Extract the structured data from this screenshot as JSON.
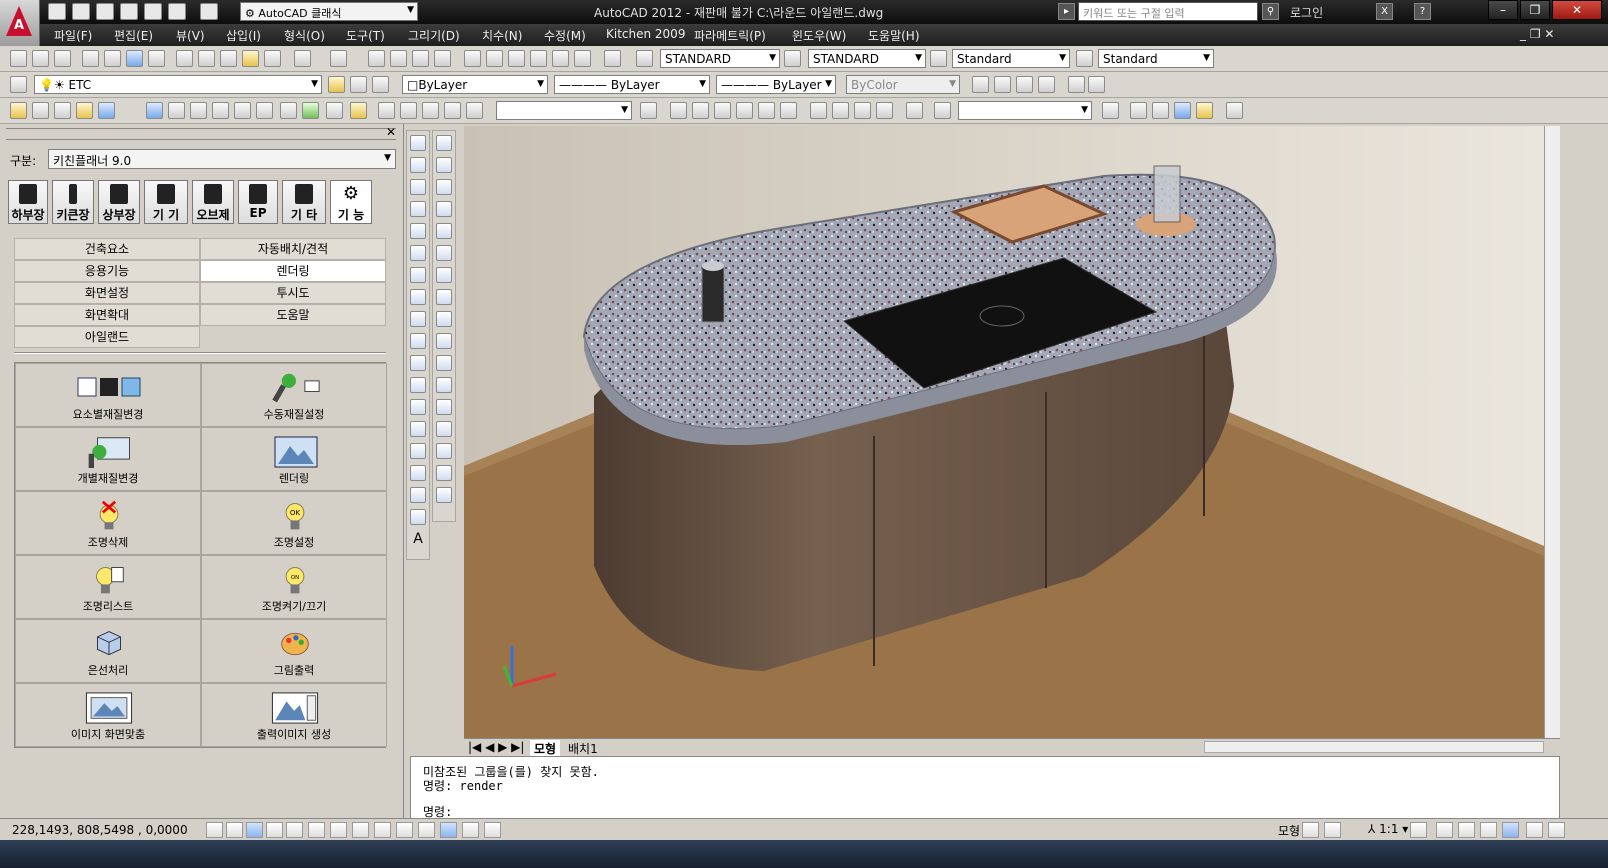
{
  "titlebar": {
    "workspace": "AutoCAD 클래식",
    "title": "AutoCAD 2012 - 재판매 불가    C:\\라운드 아일랜드.dwg",
    "search_placeholder": "키워드 또는 구절 입력",
    "login": "로그인"
  },
  "menu": [
    "파일(F)",
    "편집(E)",
    "뷰(V)",
    "삽입(I)",
    "형식(O)",
    "도구(T)",
    "그리기(D)",
    "치수(N)",
    "수정(M)",
    "Kitchen 2009",
    "파라메트릭(P)",
    "윈도우(W)",
    "도움말(H)"
  ],
  "styles": {
    "text_style": "STANDARD",
    "dim_style": "STANDARD",
    "table_style": "Standard",
    "mleader_style": "Standard"
  },
  "layers": {
    "current_layer": "ETC",
    "color": "ByLayer",
    "linetype": "ByLayer",
    "lineweight": "ByLayer",
    "plotstyle": "ByColor"
  },
  "panel": {
    "gubun_label": "구분:",
    "gubun_value": "키친플래너 9.0",
    "categories": [
      "하부장",
      "키큰장",
      "상부장",
      "기  기",
      "오브제",
      "EP",
      "기  타",
      "기  능"
    ],
    "menu_items": [
      "건축요소",
      "자동배치/견적",
      "응용기능",
      "렌더링",
      "화면설정",
      "투시도",
      "화면확대",
      "도움말",
      "아일랜드"
    ],
    "commands": [
      "요소별재질변경",
      "수동재질설정",
      "개별재질변경",
      "렌더링",
      "조명삭제",
      "조명설정",
      "조명리스트",
      "조명켜기/끄기",
      "은선처리",
      "그림출력",
      "이미지 화면맞춤",
      "출력이미지 생성"
    ]
  },
  "tabs": {
    "model": "모형",
    "layout": "배치1"
  },
  "command_line": {
    "line1": "미참조된 그룹을(를) 찾지 못함.",
    "line2": "명령: render",
    "prompt": "명령:"
  },
  "status": {
    "coords": "228,1493,  808,5498  , 0,0000",
    "model": "모형",
    "scale": "1:1"
  },
  "colors": {
    "title_bg": "#1a1a1a",
    "autocad_red": "#c8102e",
    "countertop": "#9ea3b0",
    "cabinet_wood": "#6b5749",
    "floor_wood": "#9a7448",
    "wall": "#dcd6cb"
  }
}
